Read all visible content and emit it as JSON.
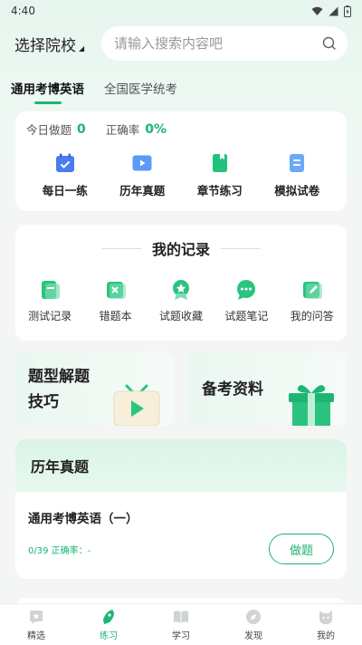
{
  "status_bar": {
    "time": "4:40"
  },
  "header": {
    "school_select": "选择院校",
    "search_placeholder": "请输入搜索内容吧"
  },
  "tabs": [
    {
      "label": "通用考博英语",
      "active": true
    },
    {
      "label": "全国医学统考",
      "active": false
    }
  ],
  "stats": {
    "done_label": "今日做题",
    "done_value": "0",
    "accuracy_label": "正确率",
    "accuracy_value": "0%"
  },
  "quick_actions": [
    {
      "label": "每日一练",
      "icon": "calendar-icon"
    },
    {
      "label": "历年真题",
      "icon": "video-icon"
    },
    {
      "label": "章节练习",
      "icon": "book-icon"
    },
    {
      "label": "模拟试卷",
      "icon": "paper-icon"
    }
  ],
  "records": {
    "title": "我的记录",
    "items": [
      {
        "label": "测试记录",
        "icon": "test-record-icon"
      },
      {
        "label": "错题本",
        "icon": "wrong-book-icon"
      },
      {
        "label": "试题收藏",
        "icon": "favorite-icon"
      },
      {
        "label": "试题笔记",
        "icon": "note-icon"
      },
      {
        "label": "我的问答",
        "icon": "qa-icon"
      }
    ]
  },
  "promos": [
    {
      "label": "题型解题技巧",
      "icon": "tv-icon"
    },
    {
      "label": "备考资料",
      "icon": "gift-icon"
    }
  ],
  "past_exams": {
    "title": "历年真题",
    "item": {
      "name": "通用考博英语（一）",
      "progress": "0/39 正确率：-",
      "button": "做题"
    }
  },
  "bottom_nav": [
    {
      "label": "精选",
      "icon": "featured-icon",
      "active": false
    },
    {
      "label": "练习",
      "icon": "practice-icon",
      "active": true
    },
    {
      "label": "学习",
      "icon": "study-icon",
      "active": false
    },
    {
      "label": "发现",
      "icon": "discover-icon",
      "active": false
    },
    {
      "label": "我的",
      "icon": "profile-icon",
      "active": false
    }
  ],
  "colors": {
    "accent": "#1db574",
    "background": "#f4f6f5"
  }
}
